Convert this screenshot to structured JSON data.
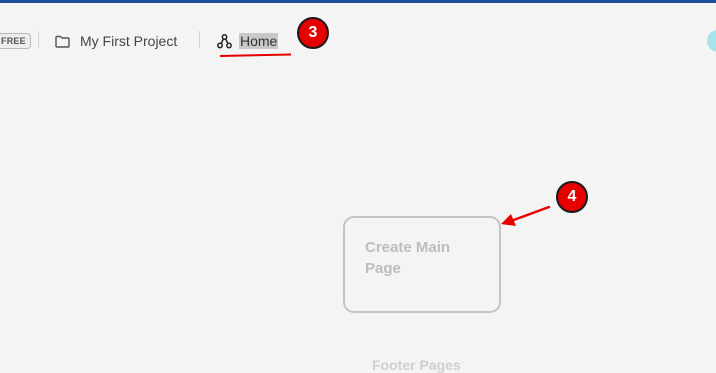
{
  "header": {
    "plan_badge": "FREE",
    "project_name": "My First Project",
    "page_name": "Home"
  },
  "annotations": {
    "step_home": "3",
    "step_card": "4"
  },
  "canvas": {
    "create_main_page": "Create Main Page",
    "footer_pages": "Footer Pages"
  },
  "icons": {
    "project": "folder-icon",
    "page": "sitemap-icon"
  },
  "colors": {
    "accent_bar": "#1c4f9c",
    "annotation_red": "#e60000",
    "avatar": "#a7e3ea",
    "background": "#f4f4f4"
  }
}
